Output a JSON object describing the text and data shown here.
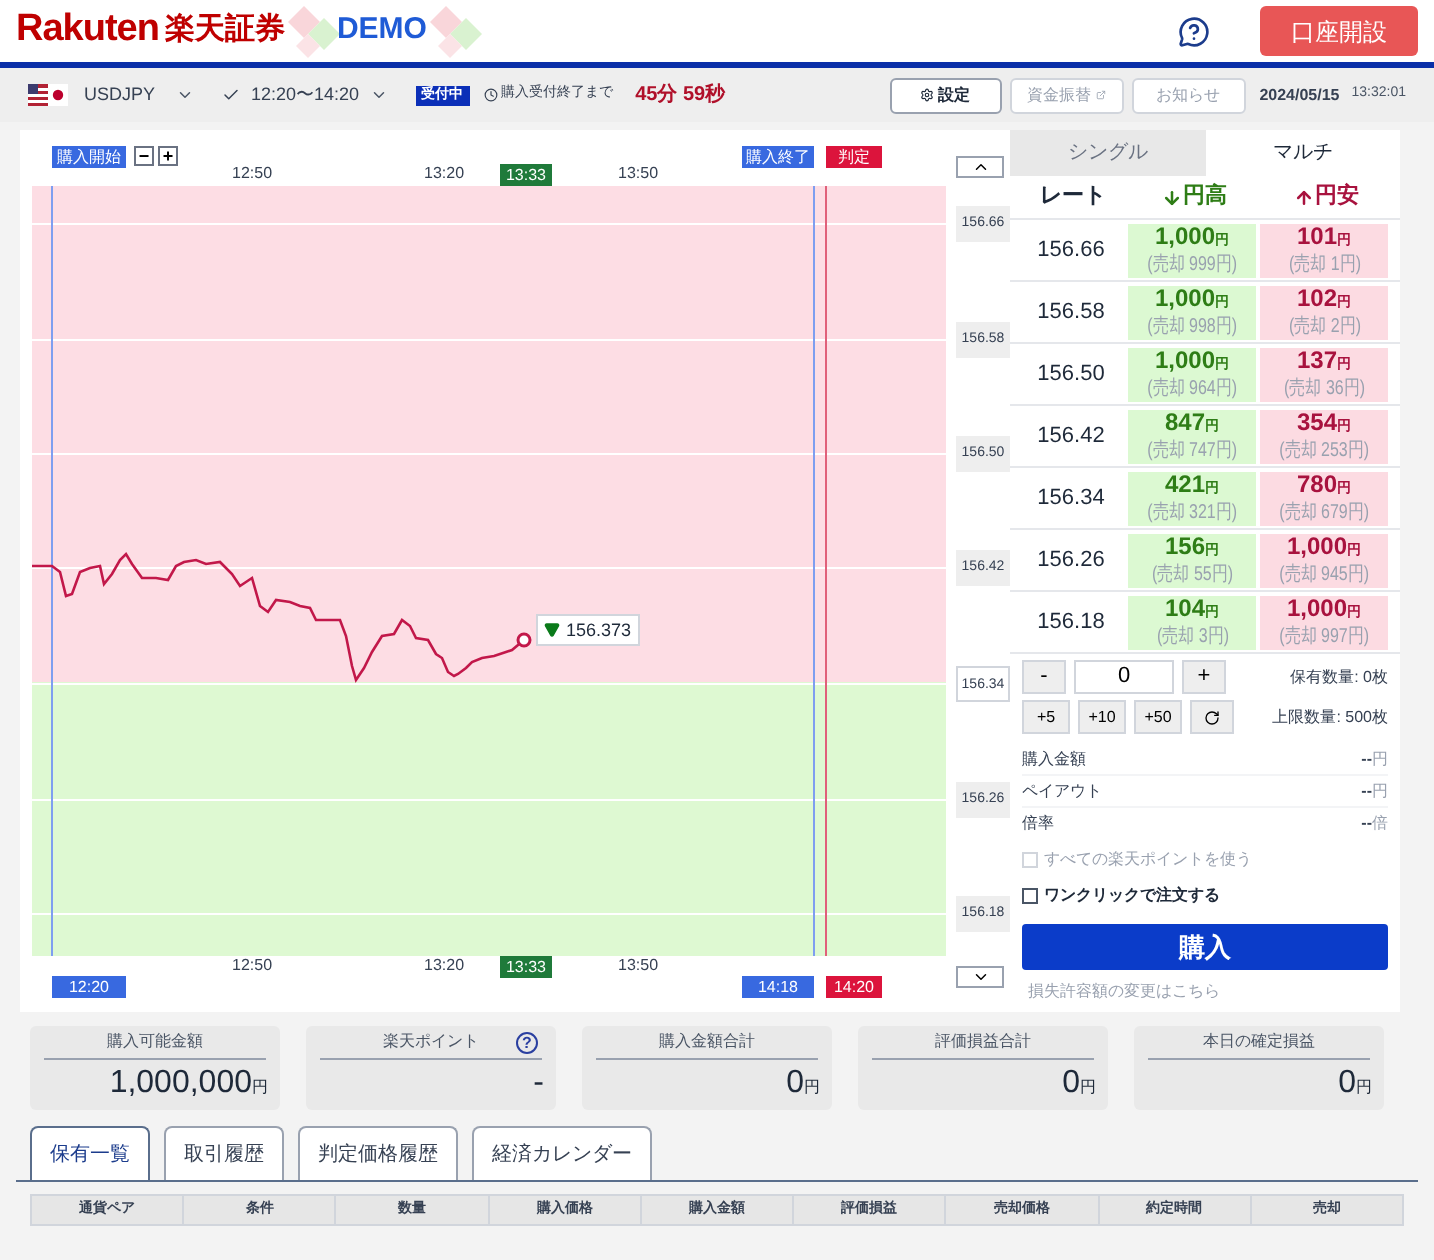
{
  "header": {
    "logo_text": "Rakuten",
    "logo_jp": "楽天証券",
    "demo": "DEMO",
    "open_account": "口座開設"
  },
  "toolbar": {
    "pair": "USDJPY",
    "session": "12:20〜14:20",
    "status": "受付中",
    "countdown_label": "購入受付終了まで",
    "countdown": "45分 59秒",
    "buttons": [
      {
        "label": "設定",
        "kind": "settings",
        "disabled": false
      },
      {
        "label": "資金振替",
        "kind": "external",
        "disabled": true
      },
      {
        "label": "お知らせ",
        "kind": "plain",
        "disabled": true
      }
    ],
    "date": "2024/05/15",
    "time": "13:32:01"
  },
  "chart": {
    "start_label": "購入開始",
    "end_label": "購入終了",
    "judge_label": "判定",
    "zoom_out": "−",
    "zoom_in": "+",
    "x_ticks": [
      "12:50",
      "13:20",
      "13:50"
    ],
    "current_time": "13:33",
    "bottom_x_ticks": [
      "12:50",
      "13:20",
      "13:50"
    ],
    "bottom_current_time": "13:33",
    "current_price": "156.373",
    "start_time": "12:20",
    "end_time": "14:18",
    "judge_time": "14:20",
    "y_ticks": [
      {
        "label": "156.66",
        "current": false
      },
      {
        "label": "156.58",
        "current": false
      },
      {
        "label": "156.50",
        "current": false
      },
      {
        "label": "156.42",
        "current": false
      },
      {
        "label": "156.34",
        "current": true
      },
      {
        "label": "156.26",
        "current": false
      },
      {
        "label": "156.18",
        "current": false
      }
    ]
  },
  "panel_tabs": [
    {
      "label": "シングル",
      "selected": false
    },
    {
      "label": "マルチ",
      "selected": true
    }
  ],
  "rate_table": {
    "columns": [
      "レート",
      "円高",
      "円安"
    ],
    "rows": [
      {
        "rate": "156.66",
        "high": {
          "price": "1,000",
          "unit": "円",
          "sell": "(売却 999円)"
        },
        "low": {
          "price": "101",
          "unit": "円",
          "sell": "(売却 1円)"
        }
      },
      {
        "rate": "156.58",
        "high": {
          "price": "1,000",
          "unit": "円",
          "sell": "(売却 998円)"
        },
        "low": {
          "price": "102",
          "unit": "円",
          "sell": "(売却 2円)"
        }
      },
      {
        "rate": "156.50",
        "high": {
          "price": "1,000",
          "unit": "円",
          "sell": "(売却 964円)"
        },
        "low": {
          "price": "137",
          "unit": "円",
          "sell": "(売却 36円)"
        }
      },
      {
        "rate": "156.42",
        "high": {
          "price": "847",
          "unit": "円",
          "sell": "(売却 747円)"
        },
        "low": {
          "price": "354",
          "unit": "円",
          "sell": "(売却 253円)"
        }
      },
      {
        "rate": "156.34",
        "high": {
          "price": "421",
          "unit": "円",
          "sell": "(売却 321円)"
        },
        "low": {
          "price": "780",
          "unit": "円",
          "sell": "(売却 679円)"
        }
      },
      {
        "rate": "156.26",
        "high": {
          "price": "156",
          "unit": "円",
          "sell": "(売却 55円)"
        },
        "low": {
          "price": "1,000",
          "unit": "円",
          "sell": "(売却 945円)"
        }
      },
      {
        "rate": "156.18",
        "high": {
          "price": "104",
          "unit": "円",
          "sell": "(売却 3円)"
        },
        "low": {
          "price": "1,000",
          "unit": "円",
          "sell": "(売却 997円)"
        }
      }
    ]
  },
  "quantity": {
    "minus": "-",
    "value": "0",
    "plus": "+",
    "steps": [
      "+5",
      "+10",
      "+50"
    ],
    "held": "保有数量: 0枚",
    "limit": "上限数量: 500枚"
  },
  "order_summary": [
    {
      "label": "購入金額",
      "value": "--",
      "unit": "円"
    },
    {
      "label": "ペイアウト",
      "value": "--",
      "unit": "円"
    },
    {
      "label": "倍率",
      "value": "--",
      "unit": "倍"
    }
  ],
  "options": [
    {
      "label": "すべての楽天ポイントを使う",
      "checked": false,
      "disabled": true
    },
    {
      "label": "ワンクリックで注文する",
      "checked": false,
      "disabled": false
    }
  ],
  "buy_button": "購入",
  "loss_link": "損失許容額の変更はこちら",
  "cards": [
    {
      "label": "購入可能金額",
      "value": "1,000,000",
      "unit": "円"
    },
    {
      "label": "楽天ポイント",
      "value": "-",
      "help": "?"
    },
    {
      "label": "購入金額合計",
      "value": "0",
      "unit": "円"
    },
    {
      "label": "評価損益合計",
      "value": "0",
      "unit": "円"
    },
    {
      "label": "本日の確定損益",
      "value": "0",
      "unit": "円"
    }
  ],
  "bottom_tabs": [
    {
      "label": "保有一覧",
      "selected": true
    },
    {
      "label": "取引履歴",
      "selected": false
    },
    {
      "label": "判定価格履歴",
      "selected": false
    },
    {
      "label": "経済カレンダー",
      "selected": false
    }
  ],
  "table": {
    "columns": [
      "通貨ペア",
      "条件",
      "数量",
      "購入価格",
      "購入金額",
      "評価損益",
      "売却価格",
      "約定時間",
      "売却"
    ]
  }
}
